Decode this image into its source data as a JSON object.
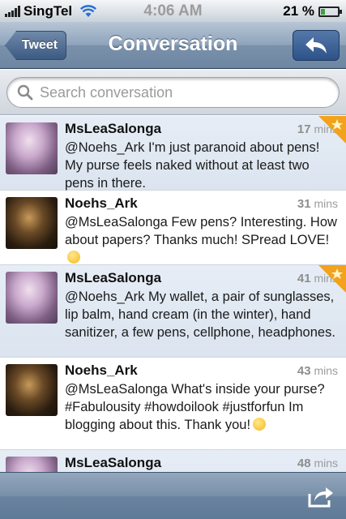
{
  "status": {
    "carrier": "SingTel",
    "time": "4:06 AM",
    "battery": "21 %",
    "battery_level": 0.21
  },
  "nav": {
    "back_label": "Tweet",
    "title": "Conversation"
  },
  "search": {
    "placeholder": "Search conversation"
  },
  "tweets": [
    {
      "user": "MsLeaSalonga",
      "age": "17",
      "unit": "mins",
      "starred": true,
      "highlight": true,
      "text": "@Noehs_Ark I'm just paranoid about pens! My purse feels naked without at least two pens in there."
    },
    {
      "user": "Noehs_Ark",
      "age": "31",
      "unit": "mins",
      "starred": false,
      "highlight": false,
      "text": "@MsLeaSalonga Few pens? Interesting. How about papers? Thanks much! SPread LOVE!"
    },
    {
      "user": "MsLeaSalonga",
      "age": "41",
      "unit": "mins",
      "starred": true,
      "highlight": true,
      "text": "@Noehs_Ark My wallet, a pair of sunglasses, lip balm, hand cream (in the winter), hand sanitizer, a few pens, cellphone, headphones."
    },
    {
      "user": "Noehs_Ark",
      "age": "43",
      "unit": "mins",
      "starred": false,
      "highlight": false,
      "text": "@MsLeaSalonga What's inside your purse? #Fabulousity #howdoilook #justforfun Im blogging about this. Thank you!"
    },
    {
      "user": "MsLeaSalonga",
      "age": "48",
      "unit": "mins",
      "starred": false,
      "highlight": false,
      "text": ""
    }
  ],
  "icons": {
    "search": "search-icon",
    "reply": "reply-arrow-icon",
    "share": "share-icon",
    "star": "favorite-star-icon"
  }
}
